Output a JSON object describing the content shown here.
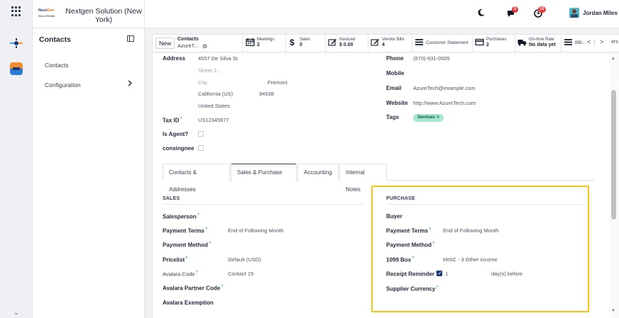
{
  "rail": {
    "more_label": "⌄"
  },
  "company": {
    "logo_text": "NextGen SOLUTIONS",
    "name": "Nextgen Solution (New York)"
  },
  "sidebar": {
    "title": "Contacts",
    "items": [
      {
        "label": "Contacts"
      },
      {
        "label": "Configuration"
      }
    ]
  },
  "topbar": {
    "messages_count": "5",
    "activities_count": "10",
    "user_name": "Jordan Miles"
  },
  "control": {
    "new_label": "New",
    "breadcrumb_parent": "Contacts",
    "breadcrumb_current": "AzureT...",
    "smart_buttons": [
      {
        "title": "Meetings",
        "value": "2"
      },
      {
        "title": "Sales",
        "value": "0"
      },
      {
        "title": "Invoiced",
        "value": "$ 0.00"
      },
      {
        "title": "Vendor Bills",
        "value": "4"
      },
      {
        "title": "Customer Statement",
        "value": ""
      },
      {
        "title": "Purchases",
        "value": "2"
      },
      {
        "title": "On-time Rate",
        "value": "No data yet"
      },
      {
        "title": "BB/...",
        "value": ""
      }
    ],
    "pager_prev": "<",
    "pager_next": ">",
    "pager_tail": "ers"
  },
  "form": {
    "address_label": "Address",
    "street": "4557 De Silva St",
    "street2_placeholder": "Street 2...",
    "city_placeholder": "City",
    "city_value": "Fremont",
    "state": "California (US)",
    "zip": "94538",
    "country": "United States",
    "taxid_label": "Tax ID",
    "taxid_value": "US12345677",
    "is_agent_label": "Is Agent?",
    "consignee_label": "consingnee",
    "phone_label": "Phone",
    "phone_value": "(870)-931-0505",
    "mobile_label": "Mobile",
    "email_label": "Email",
    "email_value": "AzureTech@example.com",
    "website_label": "Website",
    "website_value": "http://www.AzureTech.com",
    "tags_label": "Tags",
    "tag_value": "Services ✕"
  },
  "tabs": [
    {
      "label": "Contacts & Addresses"
    },
    {
      "label": "Sales & Purchase"
    },
    {
      "label": "Accounting"
    },
    {
      "label": "Internal Notes"
    }
  ],
  "sales": {
    "title": "SALES",
    "salesperson_label": "Salesperson",
    "payment_terms_label": "Payment Terms",
    "payment_terms_value": "End of Following Month",
    "payment_method_label": "Payment Method",
    "pricelist_label": "Pricelist",
    "pricelist_value": "Default (USD)",
    "avalara_code_label": "Avalara Code",
    "avalara_code_value": "Contact 15",
    "avalara_partner_label": "Avalara Partner Code",
    "avalara_exemption_label": "Avalara Exemption"
  },
  "purchase": {
    "title": "PURCHASE",
    "buyer_label": "Buyer",
    "payment_terms_label": "Payment Terms",
    "payment_terms_value": "End of Following Month",
    "payment_method_label": "Payment Method",
    "box1099_label": "1099 Box",
    "box1099_value": "MISC - 3 Other income",
    "receipt_reminder_label": "Receipt Reminder",
    "receipt_reminder_days": "1",
    "receipt_reminder_suffix": "day(s) before",
    "supplier_currency_label": "Supplier Currency"
  },
  "colors": {
    "highlight": "#f5c518",
    "brand_blue": "#1f3b7a",
    "tag_bg": "#a7e6d2",
    "badge": "#e1373c"
  }
}
